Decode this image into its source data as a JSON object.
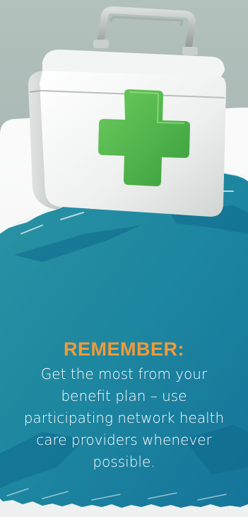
{
  "callout": {
    "heading": "REMEMBER:",
    "body": "Get the most from your benefit plan – use participating network health care providers whenever possible."
  },
  "illustration": {
    "name": "first-aid-kit",
    "cross_color": "#4cb64a",
    "case_color": "#f4f6f5"
  },
  "colors": {
    "background": "#a9b8b4",
    "panel": "#f6f7f6",
    "teal": "#1f8aa0",
    "heading": "#f29a3a",
    "body_text": "#ffffff"
  }
}
